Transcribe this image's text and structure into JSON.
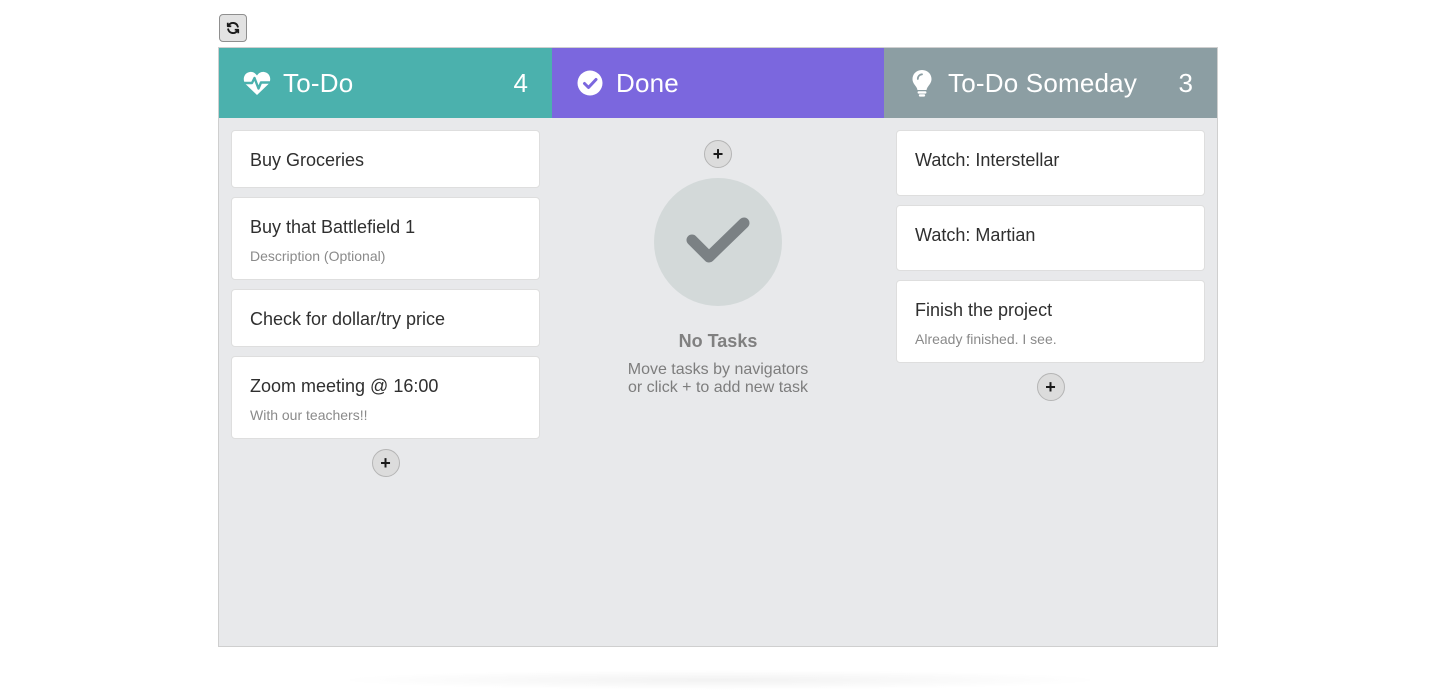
{
  "toolbar": {
    "refresh_icon": "refresh-icon"
  },
  "colors": {
    "todo": "#4bb1ad",
    "done": "#7b67de",
    "someday": "#8c9ea3",
    "board_bg": "#e8e9eb"
  },
  "columns": [
    {
      "title": "To-Do",
      "count": "4",
      "icon": "heartbeat-icon",
      "cards": [
        {
          "title": "Buy Groceries",
          "description": ""
        },
        {
          "title": "Buy that Battlefield 1",
          "description": "Description (Optional)"
        },
        {
          "title": "Check for dollar/try price",
          "description": ""
        },
        {
          "title": "Zoom meeting @ 16:00",
          "description": "With our teachers!!"
        }
      ],
      "add_label": "+"
    },
    {
      "title": "Done",
      "count": "",
      "icon": "check-circle-icon",
      "cards": [],
      "add_label": "+",
      "empty": {
        "icon": "check-icon",
        "title": "No Tasks",
        "line1": "Move tasks by navigators",
        "line2": "or click + to add new task"
      }
    },
    {
      "title": "To-Do Someday",
      "count": "3",
      "icon": "lightbulb-icon",
      "cards": [
        {
          "title": "Watch: Interstellar",
          "description": ""
        },
        {
          "title": "Watch: Martian",
          "description": ""
        },
        {
          "title": "Finish the project",
          "description": "Already finished. I see."
        }
      ],
      "add_label": "+"
    }
  ]
}
